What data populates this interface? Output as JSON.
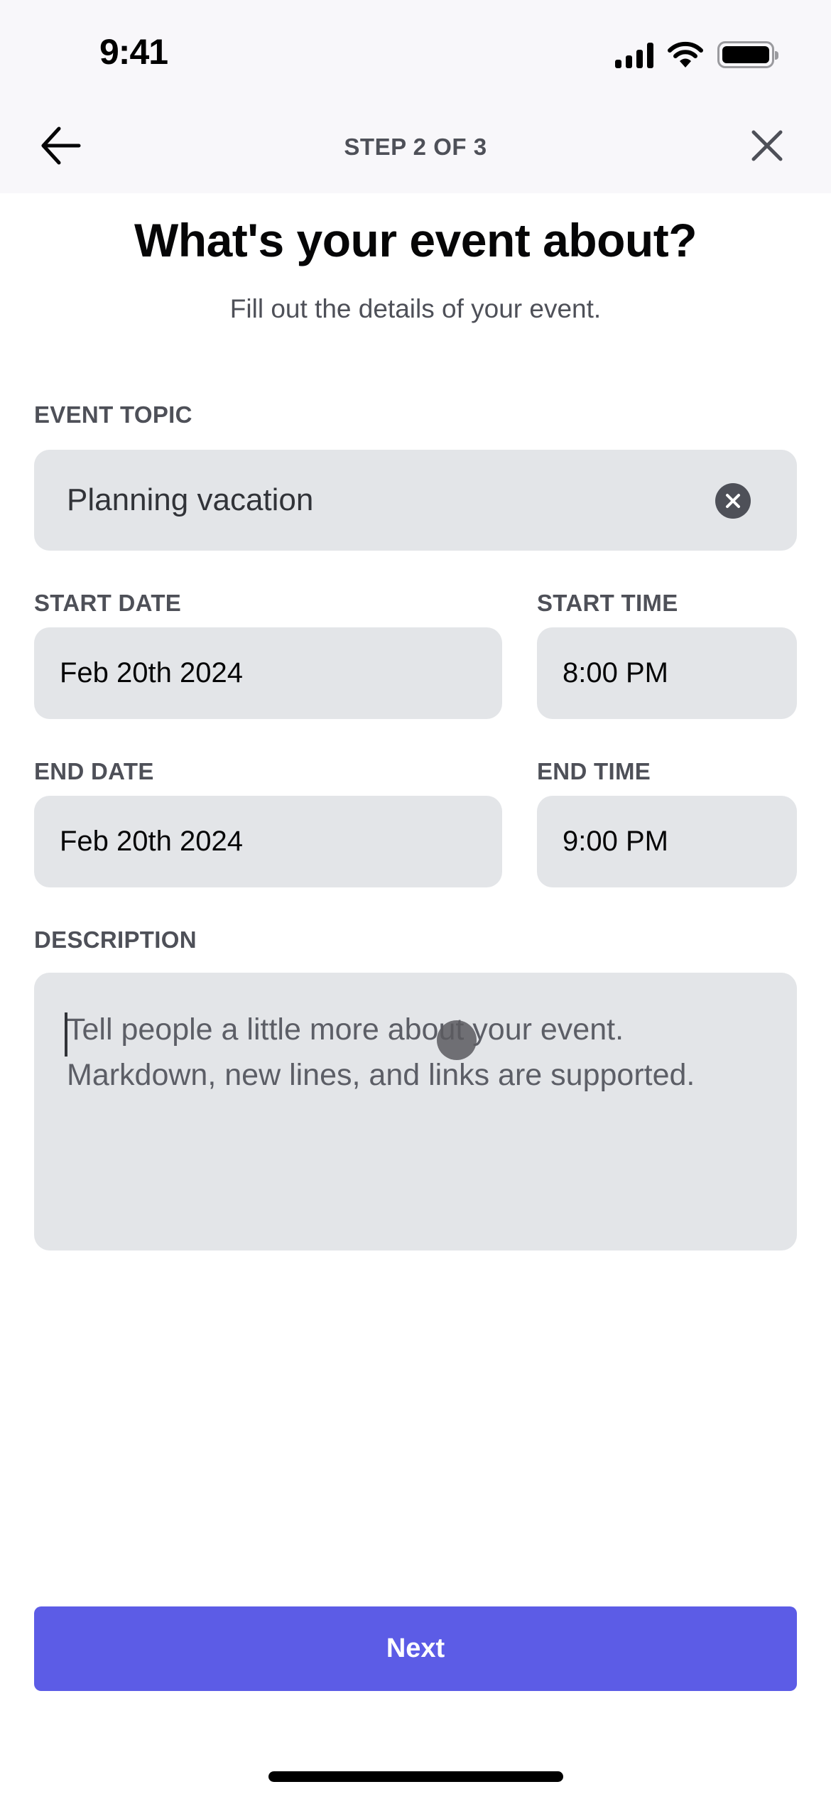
{
  "status_bar": {
    "time": "9:41",
    "icons": [
      "cellular-signal-icon",
      "wifi-icon",
      "battery-icon"
    ]
  },
  "header": {
    "back_icon": "arrow-left-icon",
    "step": "STEP 2 OF 3",
    "close_icon": "close-icon"
  },
  "page": {
    "title": "What's your event about?",
    "subtitle": "Fill out the details of your event."
  },
  "form": {
    "topic": {
      "label": "EVENT TOPIC",
      "value": "Planning vacation",
      "clear_icon": "clear-circle-icon"
    },
    "start_date": {
      "label": "START DATE",
      "value": "Feb 20th 2024"
    },
    "start_time": {
      "label": "START TIME",
      "value": "8:00 PM"
    },
    "end_date": {
      "label": "END DATE",
      "value": "Feb 20th 2024"
    },
    "end_time": {
      "label": "END TIME",
      "value": "9:00 PM"
    },
    "description": {
      "label": "DESCRIPTION",
      "value": "",
      "placeholder_line1": "Tell people a little more about your event.",
      "placeholder_line2": "Markdown, new lines, and links are supported."
    }
  },
  "actions": {
    "next_label": "Next"
  },
  "colors": {
    "accent": "#5c5ce6",
    "field_bg": "#e3e5e8",
    "label": "#4e5058",
    "header_bg": "#f8f7fa"
  }
}
